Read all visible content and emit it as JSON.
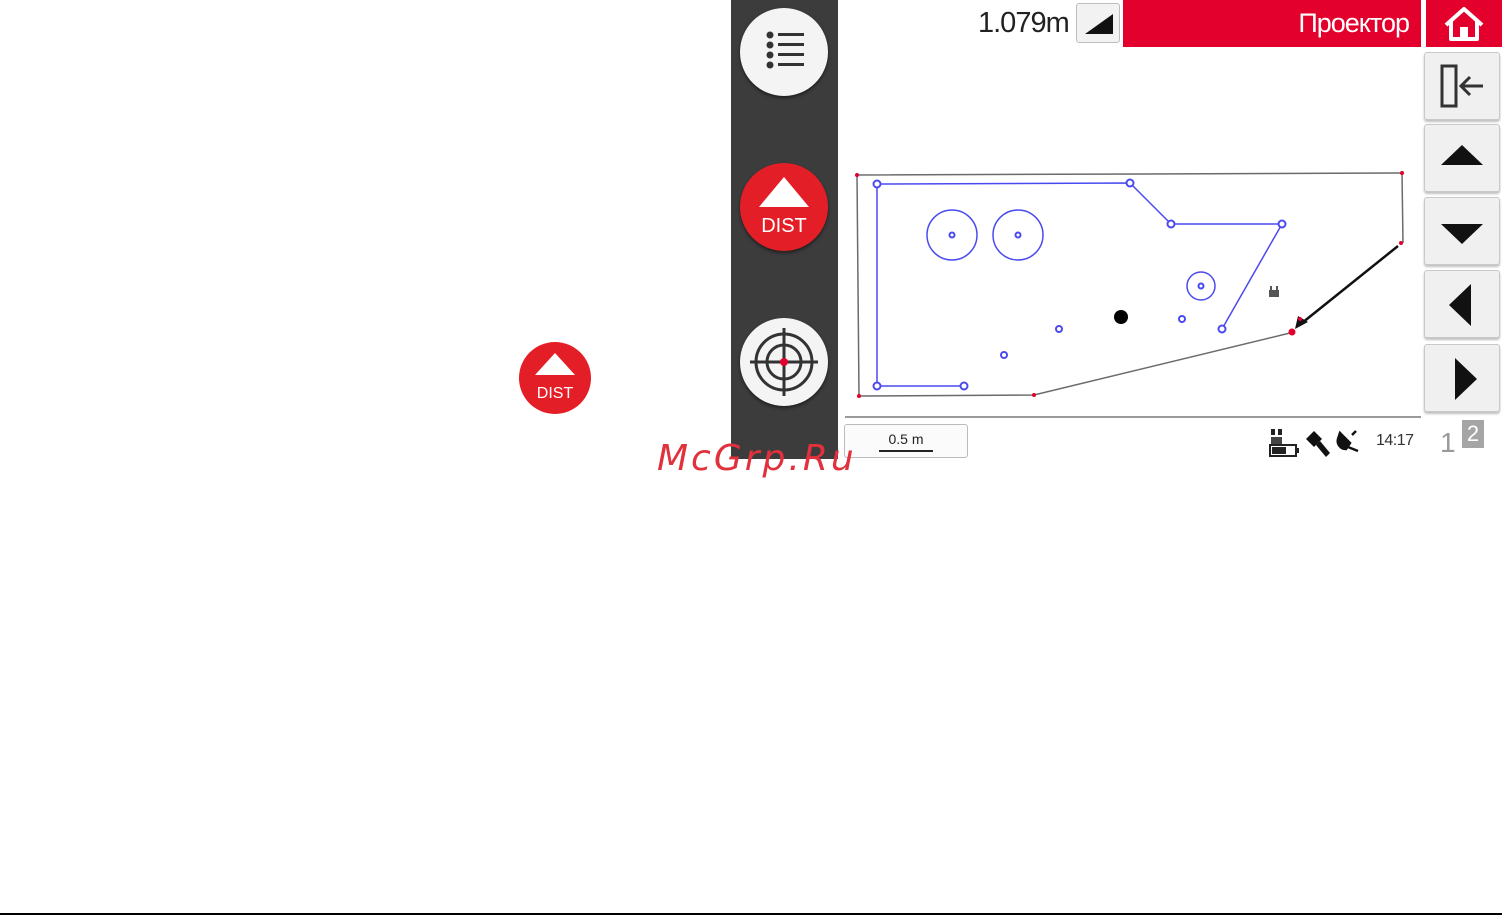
{
  "standalone_icon": {
    "label": "DIST"
  },
  "sidebar": {
    "menu_icon": "list-icon",
    "dist_button": {
      "label": "DIST"
    },
    "target_icon": "crosshair-icon"
  },
  "toolbar": {
    "distance": "1.079m",
    "tilt_icon": "slope-icon",
    "title": "Проектор",
    "home_icon": "home-icon"
  },
  "side_buttons": [
    "exit-icon",
    "arrow-up-icon",
    "arrow-down-icon",
    "arrow-left-icon",
    "arrow-right-icon"
  ],
  "status_bar": {
    "scale": "0.5 m",
    "time": "14:17",
    "page_current": "1",
    "page_next": "2",
    "icons": [
      "battery-icon",
      "laser-pointer-icon",
      "plug-icon"
    ]
  },
  "colors": {
    "accent": "#e3002d",
    "sidebar": "#3c3c3c",
    "plan_line": "#4a4af0",
    "room_line": "#6b6b6b"
  },
  "watermark": "McGrp.Ru"
}
